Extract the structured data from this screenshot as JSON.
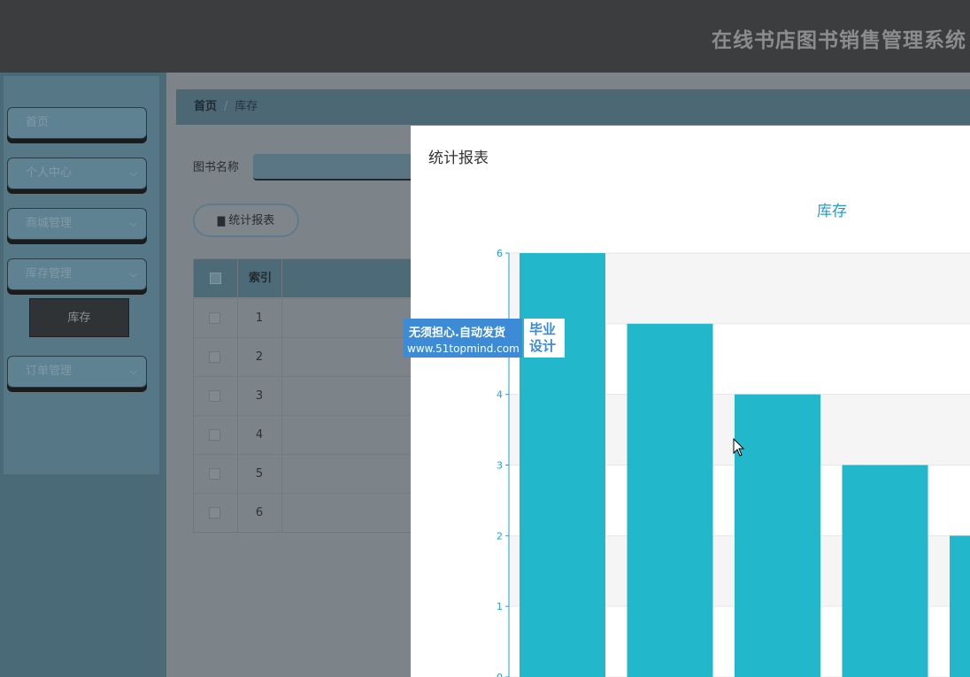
{
  "header": {
    "title": "在线书店图书销售管理系统"
  },
  "sidebar": {
    "items": [
      {
        "label": "首页",
        "has_chevron": false
      },
      {
        "label": "个人中心",
        "has_chevron": true
      },
      {
        "label": "商城管理",
        "has_chevron": true
      },
      {
        "label": "库存管理",
        "has_chevron": true
      },
      {
        "label": "订单管理",
        "has_chevron": true
      }
    ],
    "active_sub": {
      "label": "库存"
    },
    "chevron_icon": "chevron-down-icon"
  },
  "breadcrumb": {
    "home": "首页",
    "separator": "/",
    "current": "库存"
  },
  "search": {
    "label": "图书名称",
    "value": ""
  },
  "stats_button": {
    "label": "统计报表",
    "icon": "bar-chart-icon"
  },
  "table": {
    "header": {
      "index": "索引"
    },
    "rows": [
      {
        "index": "1"
      },
      {
        "index": "2"
      },
      {
        "index": "3"
      },
      {
        "index": "4"
      },
      {
        "index": "5"
      },
      {
        "index": "6"
      }
    ]
  },
  "watermark": {
    "line1": "无须担心.自动发货",
    "line2": "www.51topmind.com",
    "badge_top": "毕业",
    "badge_bottom": "设计"
  },
  "modal": {
    "title": "统计报表"
  },
  "chart_data": {
    "type": "bar",
    "title": "库存",
    "categories": [
      "",
      "",
      "",
      "",
      ""
    ],
    "values": [
      6,
      5,
      4,
      3,
      2
    ],
    "ylim": [
      0,
      6
    ],
    "yticks": [
      0,
      1,
      2,
      3,
      4,
      5,
      6
    ],
    "visible_tick_labels": [
      "0",
      "1",
      "2",
      "3",
      "4",
      "6"
    ],
    "grid": true,
    "bar_color": "#23b7cb",
    "axis_color": "#1e9fd6"
  },
  "colors": {
    "accent": "#23b7cb",
    "header_bg": "#3b3d3f"
  }
}
